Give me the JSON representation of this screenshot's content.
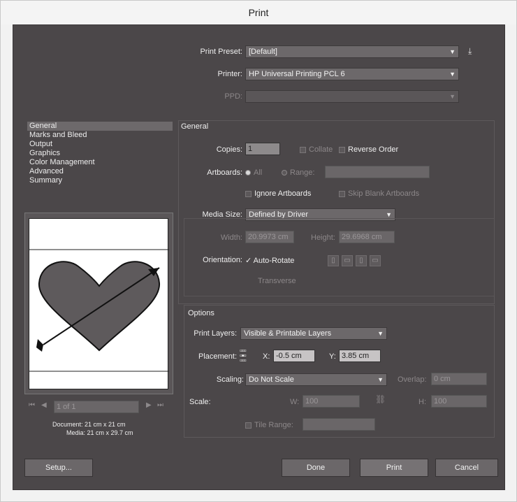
{
  "window": {
    "title": "Print"
  },
  "top": {
    "preset_label": "Print Preset:",
    "preset_value": "[Default]",
    "printer_label": "Printer:",
    "printer_value": "HP Universal Printing PCL 6",
    "ppd_label": "PPD:",
    "ppd_value": ""
  },
  "sidebar": {
    "items": [
      {
        "label": "General"
      },
      {
        "label": "Marks and Bleed"
      },
      {
        "label": "Output"
      },
      {
        "label": "Graphics"
      },
      {
        "label": "Color Management"
      },
      {
        "label": "Advanced"
      },
      {
        "label": "Summary"
      }
    ]
  },
  "general": {
    "heading": "General",
    "copies_label": "Copies:",
    "copies_value": "1",
    "collate_label": "Collate",
    "reverse_label": "Reverse Order",
    "artboards_label": "Artboards:",
    "all_label": "All",
    "range_label": "Range:",
    "range_value": "",
    "ignore_label": "Ignore Artboards",
    "skip_label": "Skip Blank Artboards",
    "media_label": "Media Size:",
    "media_value": "Defined by Driver",
    "width_label": "Width:",
    "width_value": "20.9973 cm",
    "height_label": "Height:",
    "height_value": "29.6968 cm",
    "orientation_label": "Orientation:",
    "autorotate_label": "Auto-Rotate",
    "transverse_label": "Transverse"
  },
  "options": {
    "heading": "Options",
    "layers_label": "Print Layers:",
    "layers_value": "Visible & Printable Layers",
    "placement_label": "Placement:",
    "x_label": "X:",
    "x_value": "-0.5 cm",
    "y_label": "Y:",
    "y_value": "3.85 cm",
    "scaling_label": "Scaling:",
    "scaling_value": "Do Not Scale",
    "overlap_label": "Overlap:",
    "overlap_value": "0 cm",
    "scale_label": "Scale:",
    "w_label": "W:",
    "w_value": "100",
    "h_label": "H:",
    "h_value": "100",
    "tile_label": "Tile Range:",
    "tile_value": ""
  },
  "preview": {
    "page_value": "1 of 1",
    "document_info": "Document: 21 cm x 21 cm",
    "media_info": "Media: 21 cm x 29.7 cm"
  },
  "buttons": {
    "setup": "Setup...",
    "done": "Done",
    "print": "Print",
    "cancel": "Cancel"
  },
  "colors": {
    "dialog_bg": "#4b4749",
    "heart_fill": "#5e5a5c",
    "paper": "#ffffff"
  }
}
